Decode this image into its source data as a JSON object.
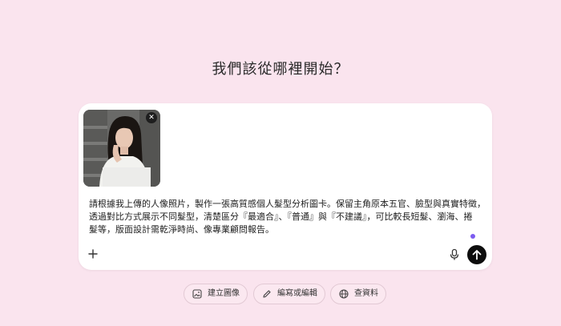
{
  "heading": "我們該從哪裡開始？",
  "composer": {
    "attachment": {
      "icon": "portrait-photo",
      "close_label": "✕"
    },
    "prompt_lines": [
      "請根據我上傳的人像照片，製作一張高質感個人髮型分析圖卡。保留主角原本五官、臉型與真實特徵，",
      "透過對比方式展示不同髮型，清楚區分『最適合』、『普通』與『不建議』，可比較長短髮、瀏海、捲",
      "髮等，版面設計需乾淨時尚、像專業顧問報告。"
    ],
    "buttons": {
      "add": "plus-icon",
      "mic": "microphone-icon",
      "send": "arrow-up-icon"
    }
  },
  "chips": [
    {
      "label": "建立圖像",
      "icon": "image-icon"
    },
    {
      "label": "編寫或編輯",
      "icon": "pencil-icon"
    },
    {
      "label": "查資料",
      "icon": "globe-icon"
    }
  ],
  "colors": {
    "background": "#fae4ee",
    "composer": "#ffffff",
    "send_button": "#0d0d0d",
    "indicator_dot": "#7c5cf0"
  }
}
